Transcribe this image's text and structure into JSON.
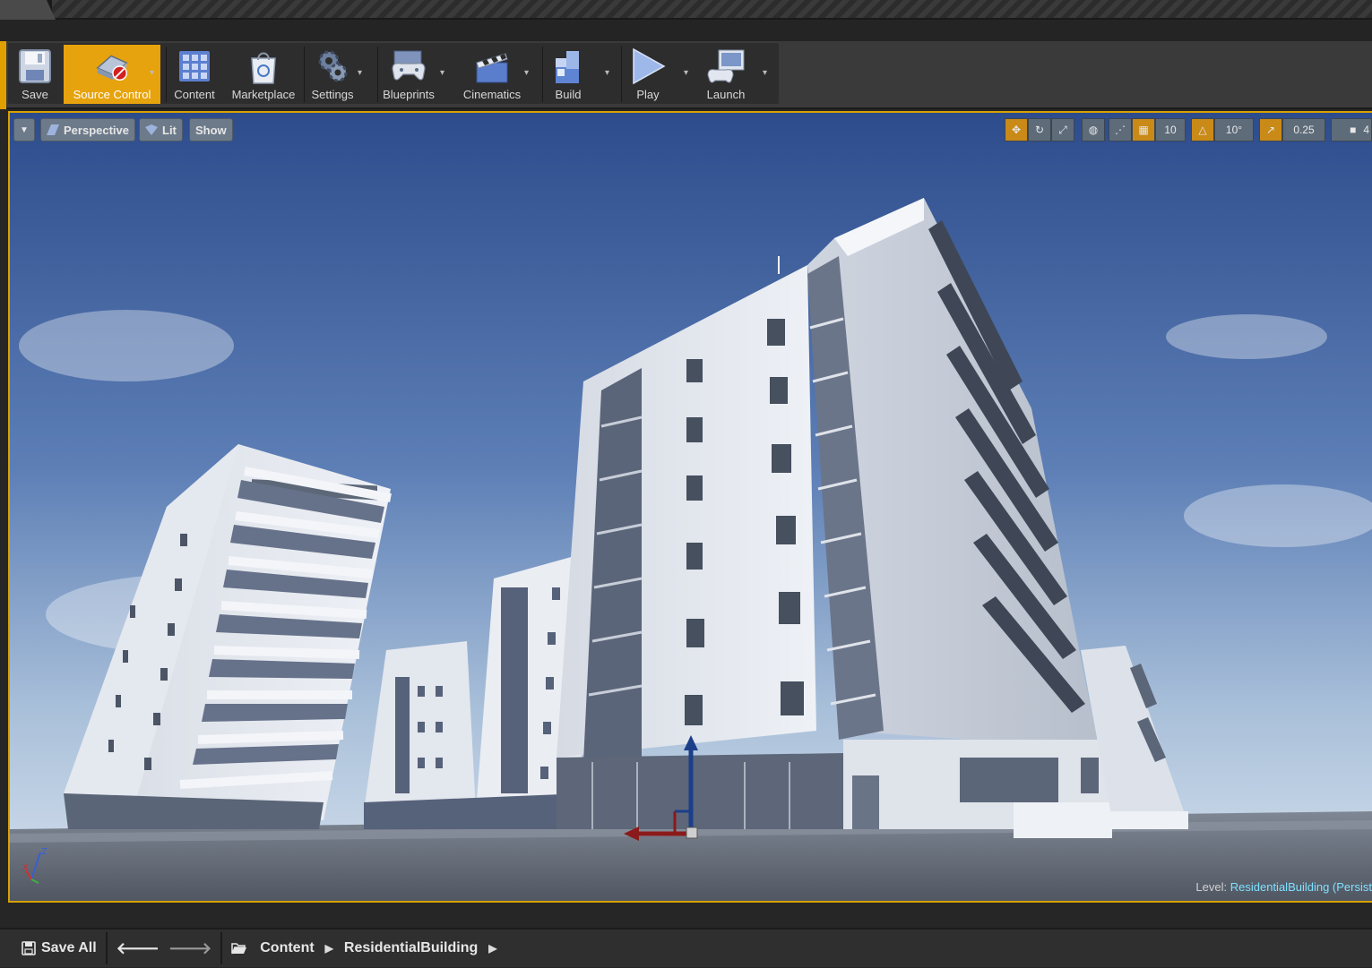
{
  "toolbar": {
    "buttons": [
      {
        "label": "Save",
        "icon": "save-icon"
      },
      {
        "label": "Source Control",
        "icon": "source-control-icon"
      },
      {
        "label": "Content",
        "icon": "content-icon"
      },
      {
        "label": "Marketplace",
        "icon": "marketplace-icon"
      },
      {
        "label": "Settings",
        "icon": "settings-icon"
      },
      {
        "label": "Blueprints",
        "icon": "blueprints-icon"
      },
      {
        "label": "Cinematics",
        "icon": "cinematics-icon"
      },
      {
        "label": "Build",
        "icon": "build-icon"
      },
      {
        "label": "Play",
        "icon": "play-icon"
      },
      {
        "label": "Launch",
        "icon": "launch-icon"
      }
    ],
    "accent_color": "#e7a30d"
  },
  "viewport": {
    "perspective_label": "Perspective",
    "lit_label": "Lit",
    "show_label": "Show",
    "grid_snap_value": "10",
    "rotation_snap_value": "10°",
    "scale_snap_value": "0.25",
    "camera_speed_value": "4",
    "level_prefix": "Level:",
    "level_name": "ResidentialBuilding (Persist"
  },
  "content_bar": {
    "save_all_label": "Save All",
    "breadcrumb": [
      "Content",
      "ResidentialBuilding"
    ]
  }
}
